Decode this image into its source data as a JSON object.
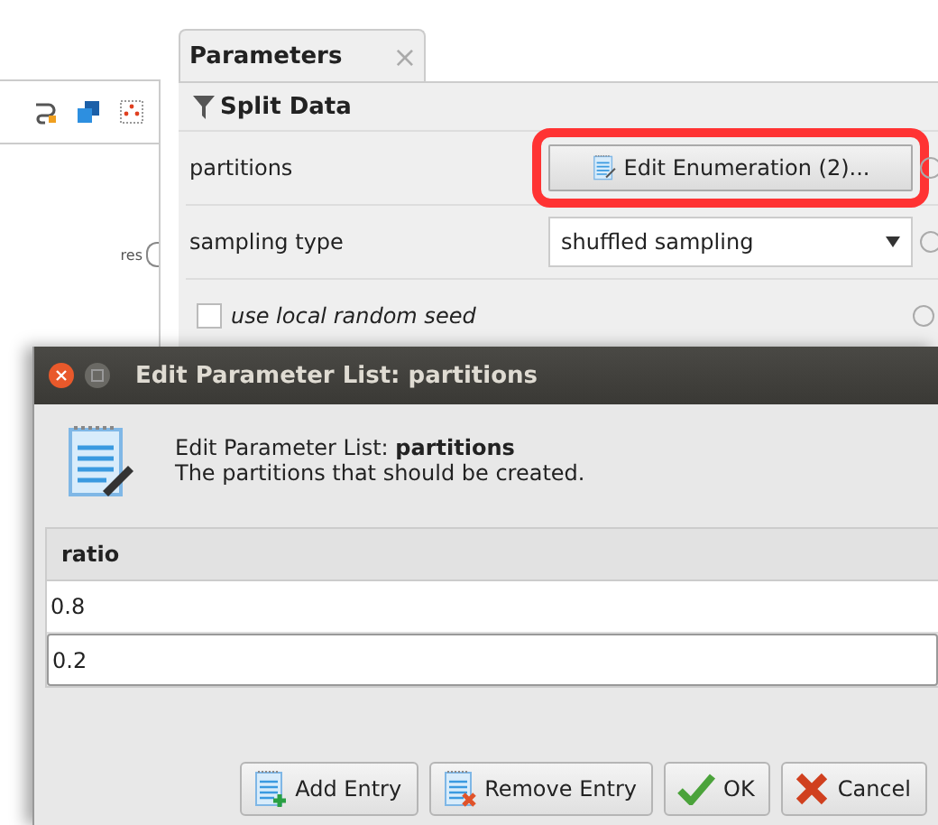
{
  "process_panel": {
    "port_label": "res"
  },
  "parameters_panel": {
    "tab": {
      "label": "Parameters",
      "close": "×"
    },
    "operator": "Split Data",
    "rows": [
      {
        "kind": "button",
        "label": "partitions",
        "value": "Edit Enumeration (2)...",
        "highlighted": true
      },
      {
        "kind": "dropdown",
        "label": "sampling type",
        "value": "shuffled sampling"
      },
      {
        "kind": "checkbox",
        "label": "use local random seed",
        "checked": false
      }
    ]
  },
  "dialog": {
    "title": "Edit Parameter List: partitions",
    "heading": "Edit Parameter List: **partitions**",
    "description": "The partitions that should be created.",
    "column": "ratio",
    "rows": [
      {
        "value": "0.8",
        "editing": false
      },
      {
        "value": "0.2",
        "editing": true
      }
    ],
    "buttons": [
      {
        "kind": "add",
        "label": "Add Entry"
      },
      {
        "kind": "remove",
        "label": "Remove Entry"
      },
      {
        "kind": "ok",
        "label": "OK"
      },
      {
        "kind": "cancel",
        "label": "Cancel"
      }
    ]
  }
}
